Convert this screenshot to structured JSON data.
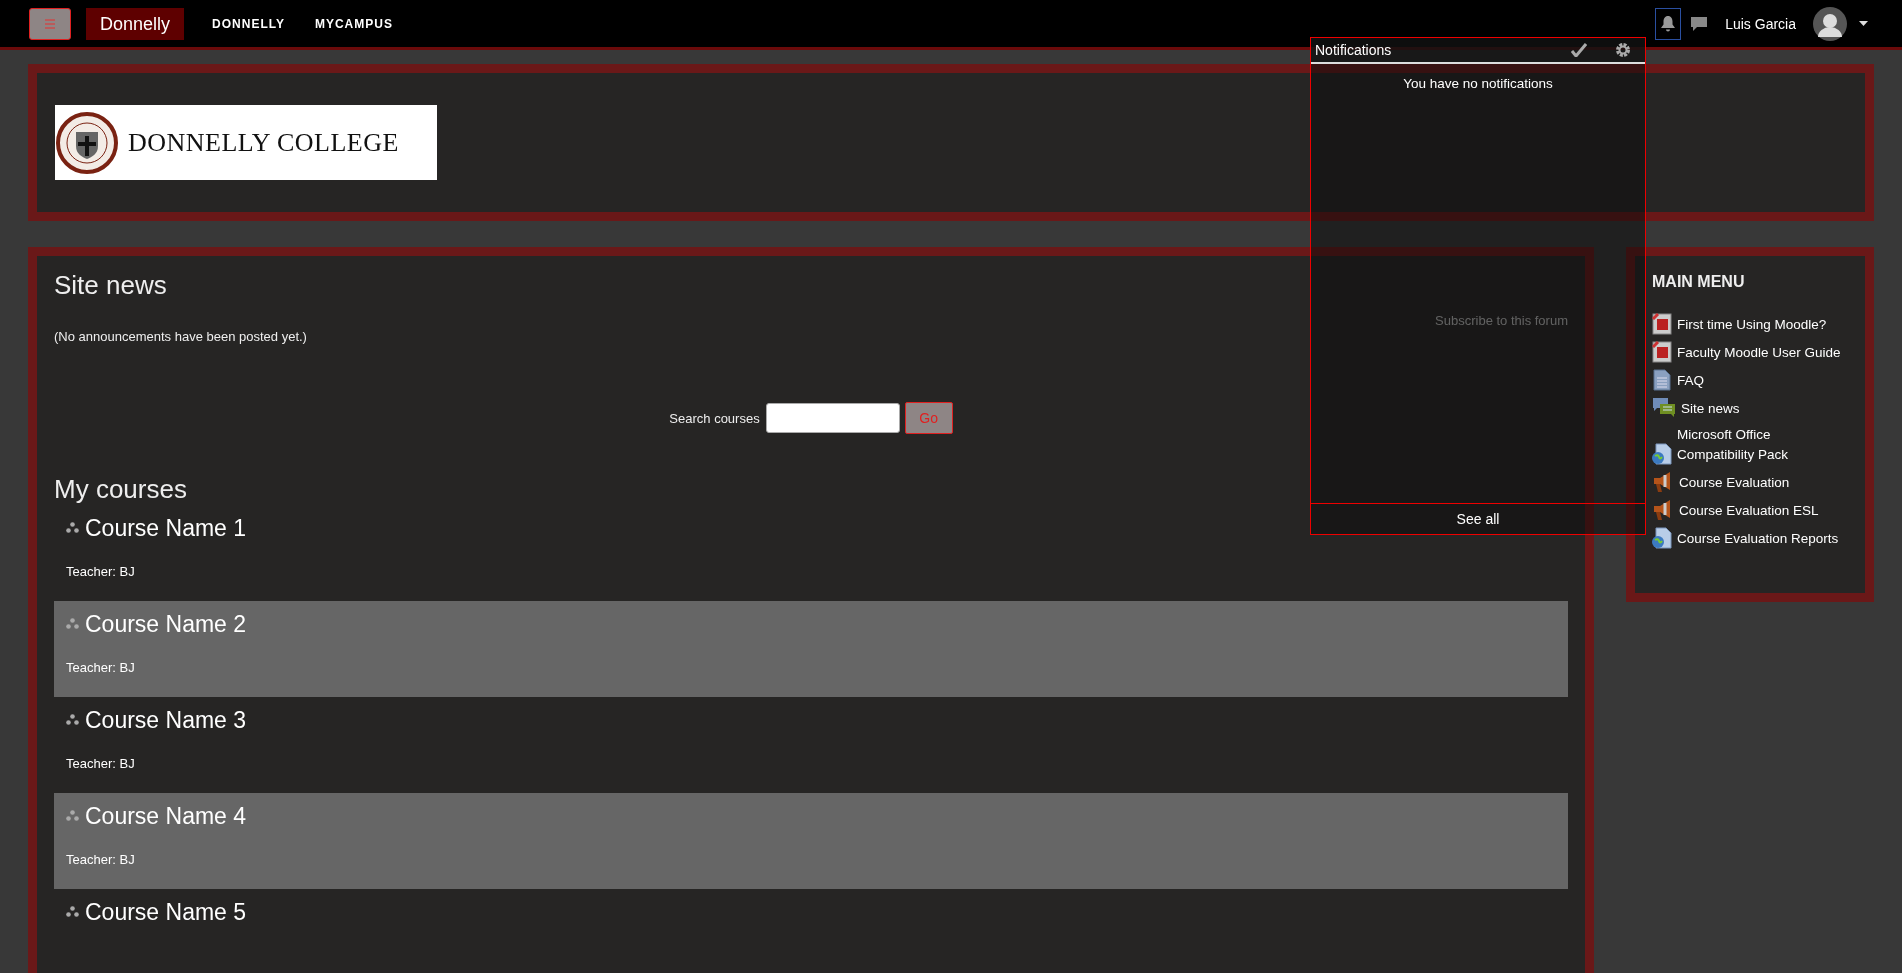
{
  "topbar": {
    "brand": "Donnelly",
    "nav": [
      "DONNELLY",
      "MYCAMPUS"
    ],
    "user_name": "Luis Garcia"
  },
  "header": {
    "logo_text": "DONNELLY COLLEGE"
  },
  "site_news": {
    "title": "Site news",
    "message": "(No announcements have been posted yet.)",
    "subscribe": "Subscribe to this forum"
  },
  "search": {
    "label": "Search courses",
    "button": "Go"
  },
  "my_courses": {
    "title": "My courses",
    "courses": [
      {
        "name": "Course Name 1",
        "teacher": "Teacher: BJ"
      },
      {
        "name": "Course Name 2",
        "teacher": "Teacher: BJ"
      },
      {
        "name": "Course Name 3",
        "teacher": "Teacher: BJ"
      },
      {
        "name": "Course Name 4",
        "teacher": "Teacher: BJ"
      },
      {
        "name": "Course Name 5"
      }
    ]
  },
  "main_menu": {
    "title": "MAIN MENU",
    "items": [
      {
        "kind": "pdf",
        "label": "First time Using Moodle?"
      },
      {
        "kind": "pdf",
        "label": "Faculty Moodle User Guide"
      },
      {
        "kind": "page",
        "label": "FAQ"
      },
      {
        "kind": "forum",
        "label": "Site news"
      },
      {
        "kind": "url",
        "label": "Microsoft Office Compatibility Pack"
      },
      {
        "kind": "feedback",
        "label": "Course Evaluation"
      },
      {
        "kind": "feedback",
        "label": "Course Evaluation ESL"
      },
      {
        "kind": "url",
        "label": "Course Evaluation Reports"
      }
    ]
  },
  "notifications": {
    "title": "Notifications",
    "empty_text": "You have no notifications",
    "footer": "See all"
  }
}
